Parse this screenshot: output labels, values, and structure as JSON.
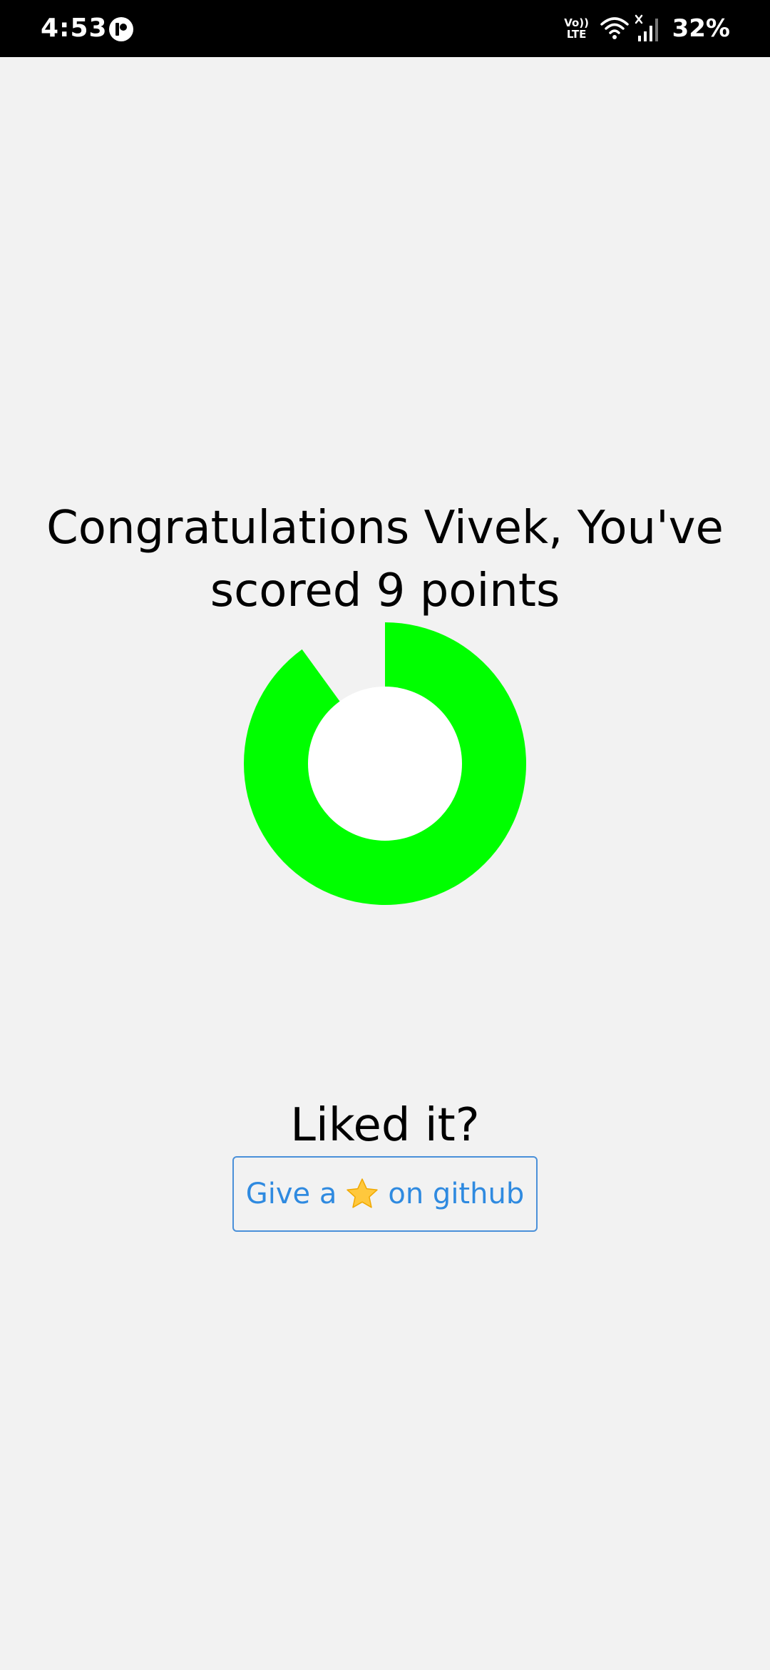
{
  "status_bar": {
    "time": "4:53",
    "app_icon": "app-notification-icon",
    "volte_line1": "Vo))",
    "volte_line2": "LTE",
    "wifi_icon": "wifi-icon",
    "signal_icon": "cell-signal-icon",
    "battery": "32%"
  },
  "result": {
    "headline": "Congratulations Vivek, You've scored 9 points",
    "score": 9,
    "score_max": 10,
    "ring_color": "#00ff00",
    "ring_center_color": "#ffffff"
  },
  "feedback": {
    "question": "Liked it?",
    "button_prefix": "Give a",
    "button_icon": "star-icon",
    "button_icon_glyph": "⭐",
    "button_suffix": "on github"
  },
  "colors": {
    "background": "#f2f2f2",
    "status_bar": "#000000",
    "link_blue": "#2f8ae0"
  }
}
